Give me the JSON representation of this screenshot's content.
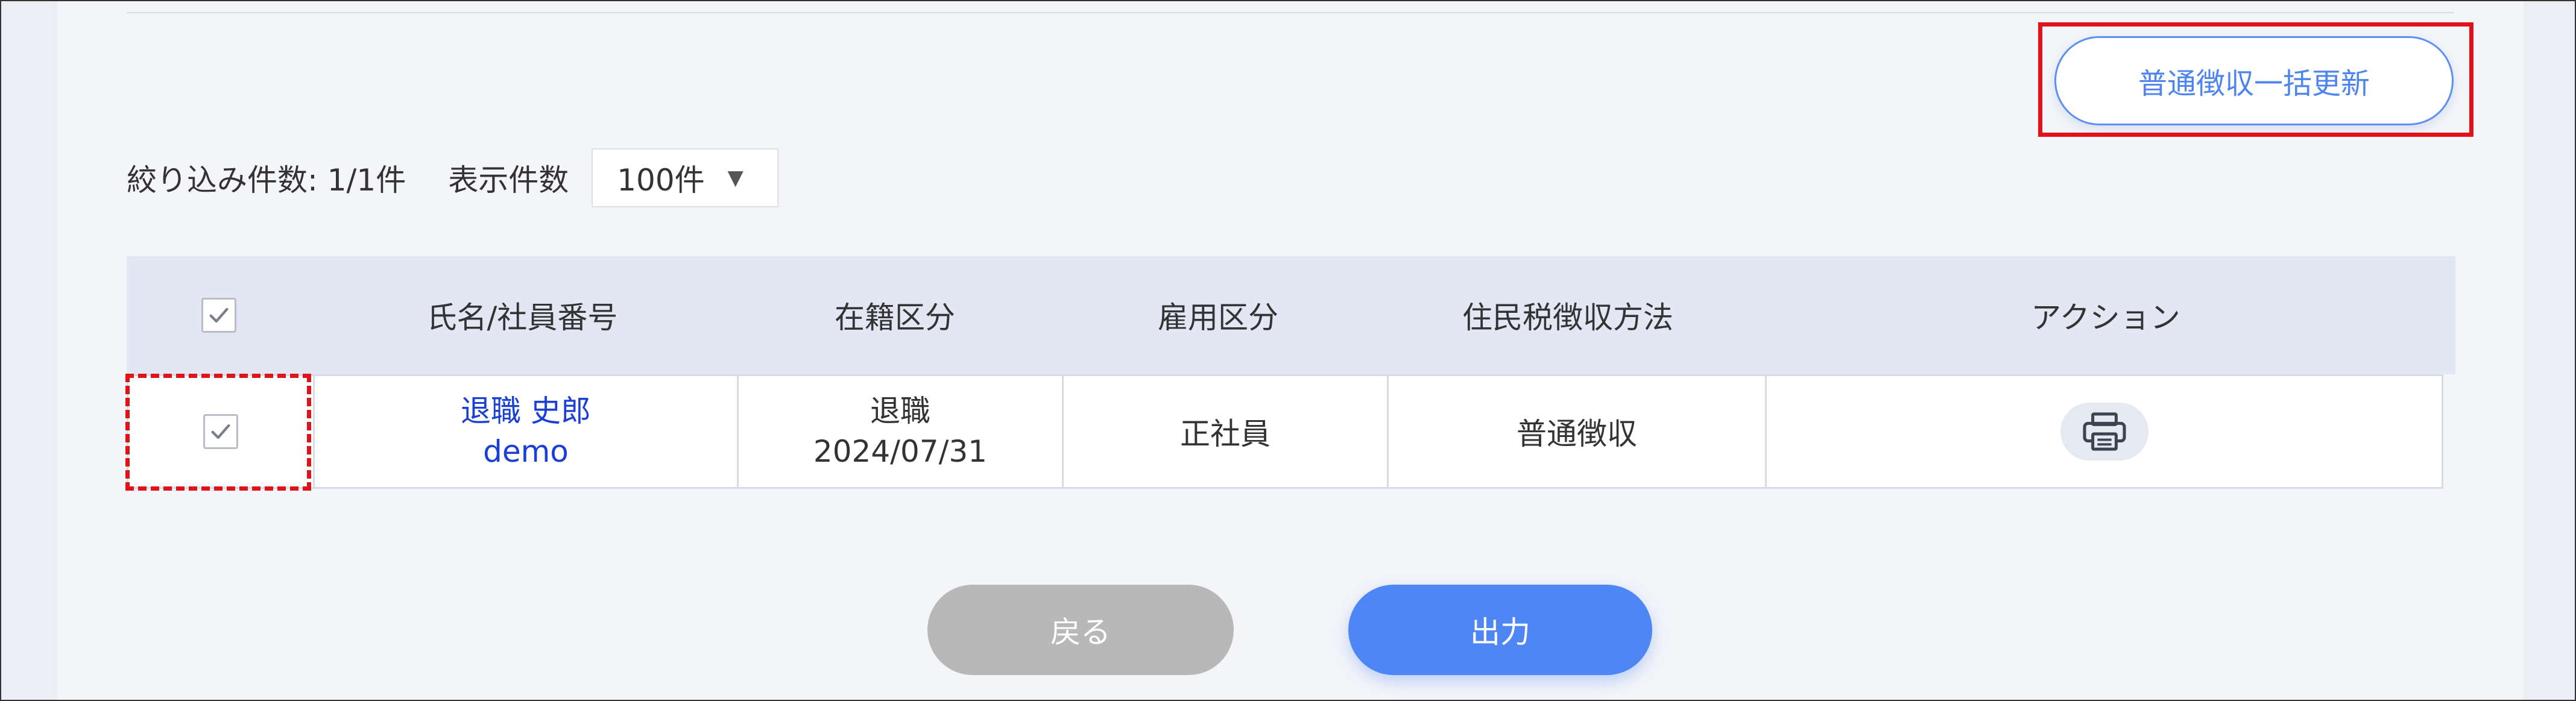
{
  "bulk_update_button": {
    "label": "普通徴収一括更新"
  },
  "filter": {
    "count_text": "絞り込み件数: 1/1件",
    "page_size_label": "表示件数",
    "page_size_value": "100件"
  },
  "table": {
    "headers": {
      "name": "氏名/社員番号",
      "status": "在籍区分",
      "employment": "雇用区分",
      "tax_method": "住民税徴収方法",
      "action": "アクション"
    },
    "rows": [
      {
        "name": "退職 史郎",
        "employee_id": "demo",
        "status": "退職",
        "status_date": "2024/07/31",
        "employment": "正社員",
        "tax_method": "普通徴収"
      }
    ]
  },
  "footer": {
    "back_label": "戻る",
    "output_label": "出力"
  },
  "colors": {
    "accent": "#4f86f6",
    "highlight_red": "#e0121a",
    "link_blue": "#1a3fd6",
    "disabled_gray": "#b8b8b8"
  },
  "icons": {
    "header_checkbox": "checkmark-icon",
    "row_checkbox": "checkmark-icon",
    "action": "printer-icon",
    "page_size_caret": "caret-down-icon"
  }
}
